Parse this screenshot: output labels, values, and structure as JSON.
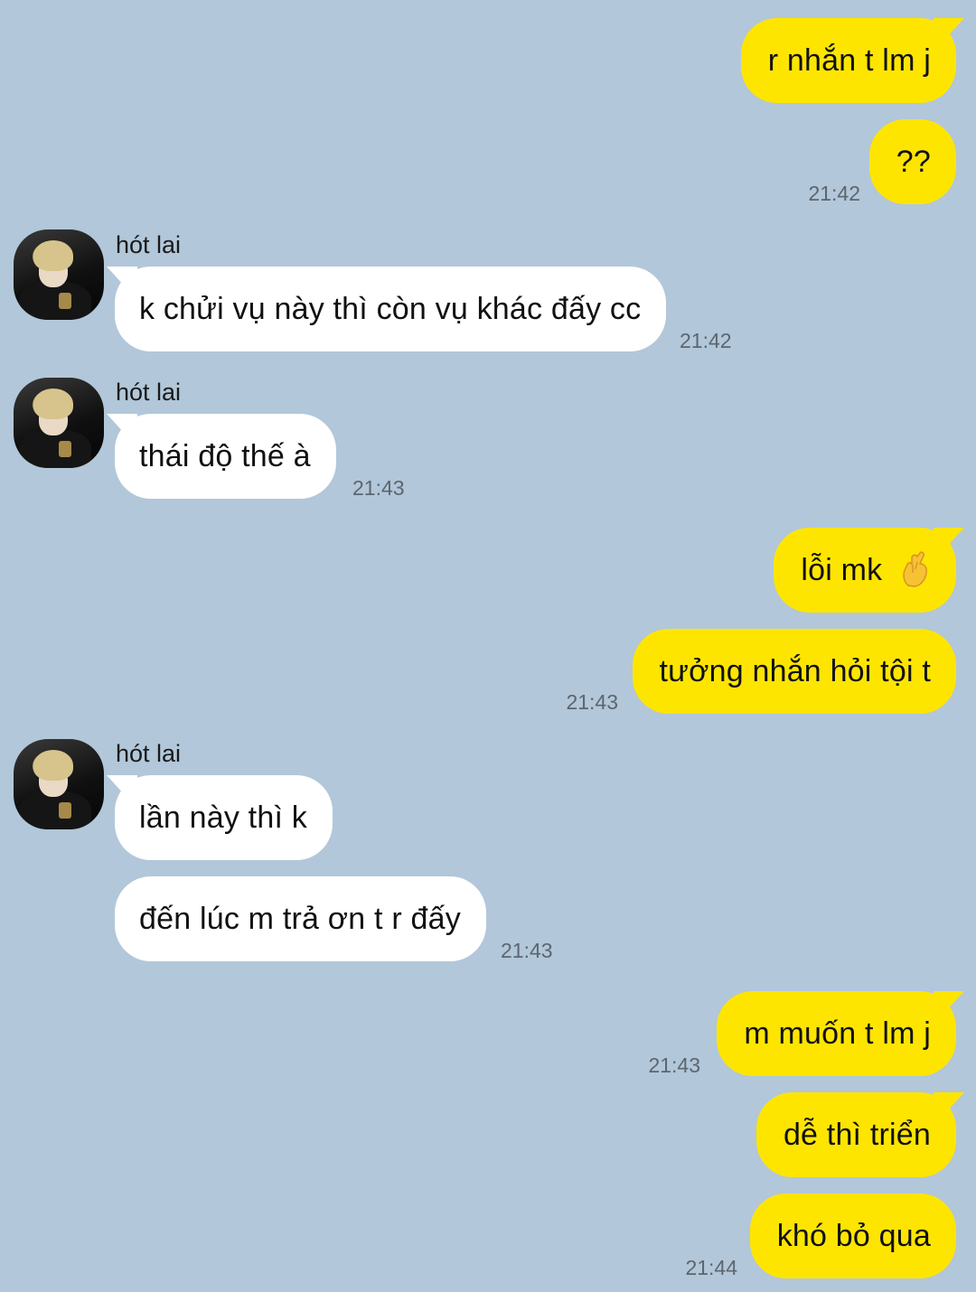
{
  "contact": {
    "name": "hót lai"
  },
  "messages": [
    {
      "dir": "out",
      "text": "r nhắn t lm j"
    },
    {
      "dir": "out",
      "text": "??",
      "time": "21:42"
    },
    {
      "dir": "in",
      "text": "k chửi vụ này thì còn vụ khác đấy cc",
      "time": "21:42"
    },
    {
      "dir": "in",
      "text": "thái độ thế à",
      "time": "21:43"
    },
    {
      "dir": "out",
      "text": "lỗi mk",
      "emoji": "crossed-fingers-icon"
    },
    {
      "dir": "out",
      "text": "tưởng nhắn hỏi tội t",
      "time": "21:43"
    },
    {
      "dir": "in",
      "text": "lần này thì k"
    },
    {
      "dir": "in",
      "text": "đến lúc m trả ơn t r đấy",
      "time": "21:43"
    },
    {
      "dir": "out",
      "text": "m muốn t lm j",
      "time": "21:43"
    },
    {
      "dir": "out",
      "text": "dễ thì triển"
    },
    {
      "dir": "out",
      "text": "khó bỏ qua",
      "time": "21:44"
    }
  ],
  "colors": {
    "background": "#b2c7d9",
    "outgoing_bubble": "#fee500",
    "incoming_bubble": "#ffffff"
  }
}
